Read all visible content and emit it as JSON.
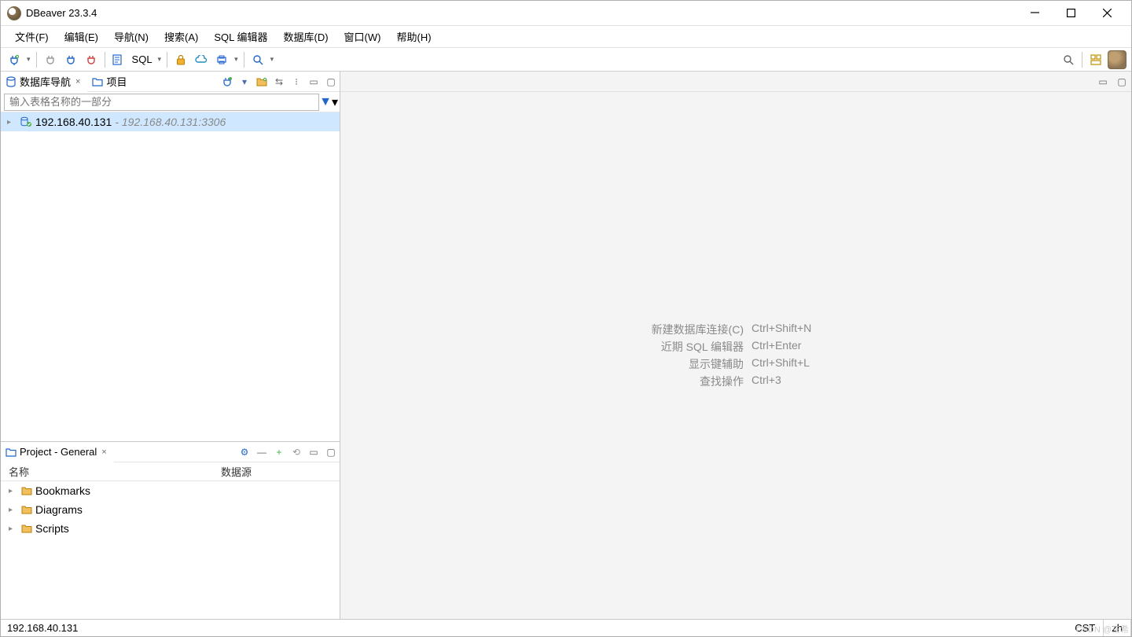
{
  "titlebar": {
    "title": "DBeaver 23.3.4"
  },
  "menu": {
    "file": "文件(F)",
    "edit": "编辑(E)",
    "navigate": "导航(N)",
    "search": "搜索(A)",
    "sql": "SQL 编辑器",
    "database": "数据库(D)",
    "window": "窗口(W)",
    "help": "帮助(H)"
  },
  "toolbar": {
    "sql_label": "SQL"
  },
  "navigator": {
    "tab_db_nav": "数据库导航",
    "tab_projects": "项目",
    "filter_placeholder": "输入表格名称的一部分",
    "tree": [
      {
        "name": "192.168.40.131",
        "meta": "- 192.168.40.131:3306"
      }
    ]
  },
  "project": {
    "title": "Project - General",
    "columns": {
      "name": "名称",
      "datasource": "数据源"
    },
    "items": [
      {
        "name": "Bookmarks"
      },
      {
        "name": "Diagrams"
      },
      {
        "name": "Scripts"
      }
    ]
  },
  "welcome": {
    "rows": [
      {
        "label": "新建数据库连接(C)",
        "shortcut": "Ctrl+Shift+N"
      },
      {
        "label": "近期 SQL 编辑器",
        "shortcut": "Ctrl+Enter"
      },
      {
        "label": "显示键辅助",
        "shortcut": "Ctrl+Shift+L"
      },
      {
        "label": "查找操作",
        "shortcut": "Ctrl+3"
      }
    ]
  },
  "status": {
    "host": "192.168.40.131",
    "tz": "CST",
    "lang": "zh"
  },
  "watermark": "CSDN @三希"
}
